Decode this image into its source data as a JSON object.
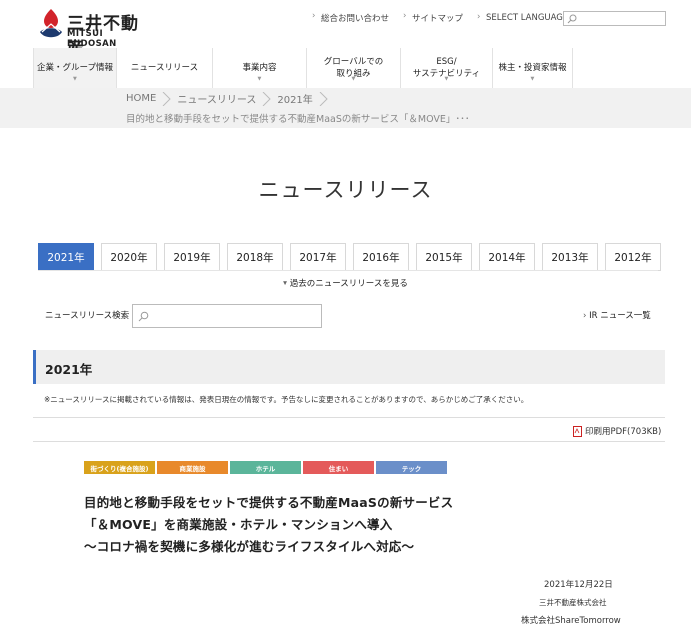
{
  "logo": {
    "jp": "三井不動産",
    "en": "MITSUI FUDOSAN"
  },
  "utility": {
    "items": [
      "総合お問い合わせ",
      "サイトマップ",
      "SELECT LANGUAGE"
    ],
    "search_placeholder": ""
  },
  "nav": {
    "items": [
      {
        "label": "企業・グループ情報"
      },
      {
        "label": "ニュースリリース"
      },
      {
        "label": "事業内容"
      },
      {
        "label": "グローバルでの\n取り組み"
      },
      {
        "label": "ESG/\nサステナビリティ"
      },
      {
        "label": "株主・投資家情報"
      }
    ]
  },
  "breadcrumb": {
    "items": [
      "HOME",
      "ニュースリリース",
      "2021年"
    ],
    "current_title": "目的地と移動手段をセットで提供する不動産MaaSの新サービス「＆MOVE」･･･"
  },
  "page_title": "ニュースリリース",
  "years": [
    "2021年",
    "2020年",
    "2019年",
    "2018年",
    "2017年",
    "2016年",
    "2015年",
    "2014年",
    "2013年",
    "2012年"
  ],
  "active_year": "2021年",
  "past_link": "過去のニュースリリースを見る",
  "search": {
    "label": "ニュースリリース検索",
    "placeholder": ""
  },
  "ir_link": "IR ニュース一覧",
  "section_heading": "2021年",
  "notice": "※ニュースリリースに掲載されている情報は、発表日現在の情報です。予告なしに変更されることがありますので、あらかじめご了承ください。",
  "pdf_link": "印刷用PDF(703KB)",
  "tags": [
    {
      "label": "街づくり(複合施設)",
      "color": "#d9a21b"
    },
    {
      "label": "商業施設",
      "color": "#e8892b"
    },
    {
      "label": "ホテル",
      "color": "#5bb59a"
    },
    {
      "label": "住まい",
      "color": "#e45a5a"
    },
    {
      "label": "テック",
      "color": "#6b8fc9"
    }
  ],
  "headline": {
    "line1": "目的地と移動手段をセットで提供する不動産MaaSの新サービス",
    "line2": "「＆MOVE」を商業施設・ホテル・マンションへ導入",
    "line3": "～コロナ禍を契機に多様化が進むライフスタイルへ対応～"
  },
  "date": "2021年12月22日",
  "companies": [
    "三井不動産株式会社",
    "株式会社ShareTomorrow"
  ],
  "colors": {
    "accent": "#3a6fc4",
    "logo_red": "#d2232a",
    "logo_navy": "#1d3a6e"
  }
}
